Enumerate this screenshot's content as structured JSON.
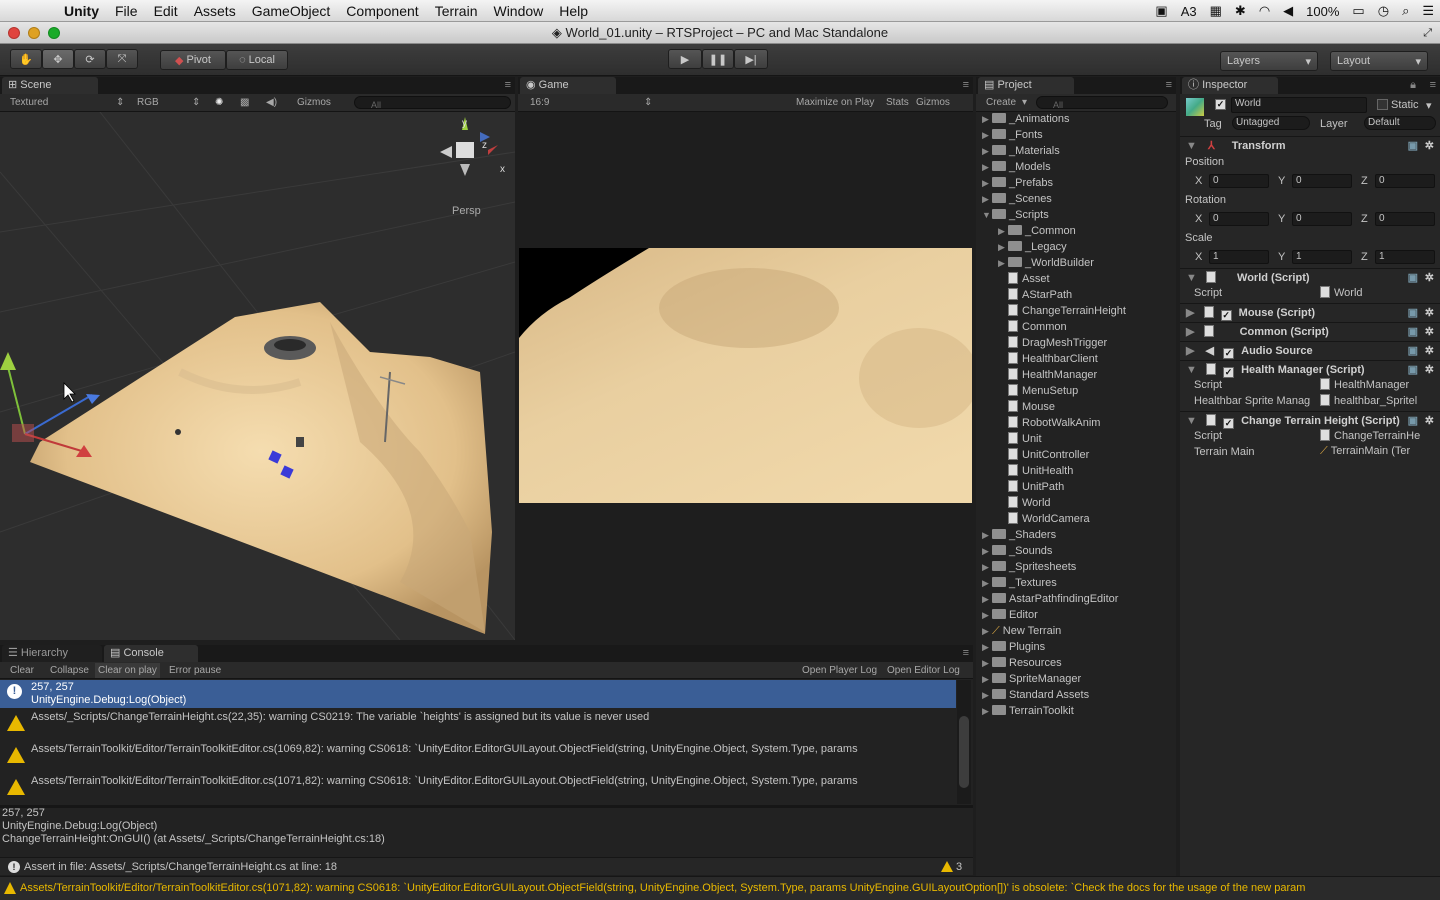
{
  "menubar": {
    "app": "Unity",
    "items": [
      "File",
      "Edit",
      "Assets",
      "GameObject",
      "Component",
      "Terrain",
      "Window",
      "Help"
    ],
    "status_num": "3",
    "battery": "100%"
  },
  "window": {
    "title": "World_01.unity – RTSProject – PC and Mac Standalone"
  },
  "toolbar": {
    "pivot": "Pivot",
    "local": "Local",
    "layers": "Layers",
    "layout": "Layout"
  },
  "scene": {
    "tab": "Scene",
    "draw_mode": "Textured",
    "color_mode": "RGB",
    "gizmos": "Gizmos",
    "search_placeholder": "All",
    "persp": "Persp",
    "axis_y": "y",
    "axis_x": "x",
    "axis_z": "z"
  },
  "game": {
    "tab": "Game",
    "aspect": "16:9",
    "maximize": "Maximize on Play",
    "stats": "Stats",
    "gizmos": "Gizmos"
  },
  "project": {
    "tab": "Project",
    "create": "Create",
    "search_placeholder": "All",
    "items": [
      {
        "label": "_Animations",
        "kind": "folder",
        "depth": 0,
        "arrow": "▶"
      },
      {
        "label": "_Fonts",
        "kind": "folder",
        "depth": 0,
        "arrow": "▶"
      },
      {
        "label": "_Materials",
        "kind": "folder",
        "depth": 0,
        "arrow": "▶"
      },
      {
        "label": "_Models",
        "kind": "folder",
        "depth": 0,
        "arrow": "▶"
      },
      {
        "label": "_Prefabs",
        "kind": "folder",
        "depth": 0,
        "arrow": "▶"
      },
      {
        "label": "_Scenes",
        "kind": "folder",
        "depth": 0,
        "arrow": "▶"
      },
      {
        "label": "_Scripts",
        "kind": "folder",
        "depth": 0,
        "arrow": "▼"
      },
      {
        "label": "_Common",
        "kind": "folder",
        "depth": 1,
        "arrow": "▶"
      },
      {
        "label": "_Legacy",
        "kind": "folder",
        "depth": 1,
        "arrow": "▶"
      },
      {
        "label": "_WorldBuilder",
        "kind": "folder",
        "depth": 1,
        "arrow": "▶"
      },
      {
        "label": "Asset",
        "kind": "file",
        "depth": 1,
        "arrow": ""
      },
      {
        "label": "AStarPath",
        "kind": "file",
        "depth": 1,
        "arrow": ""
      },
      {
        "label": "ChangeTerrainHeight",
        "kind": "file",
        "depth": 1,
        "arrow": ""
      },
      {
        "label": "Common",
        "kind": "file",
        "depth": 1,
        "arrow": ""
      },
      {
        "label": "DragMeshTrigger",
        "kind": "file",
        "depth": 1,
        "arrow": ""
      },
      {
        "label": "HealthbarClient",
        "kind": "file",
        "depth": 1,
        "arrow": ""
      },
      {
        "label": "HealthManager",
        "kind": "file",
        "depth": 1,
        "arrow": ""
      },
      {
        "label": "MenuSetup",
        "kind": "file",
        "depth": 1,
        "arrow": ""
      },
      {
        "label": "Mouse",
        "kind": "file",
        "depth": 1,
        "arrow": ""
      },
      {
        "label": "RobotWalkAnim",
        "kind": "file",
        "depth": 1,
        "arrow": ""
      },
      {
        "label": "Unit",
        "kind": "file",
        "depth": 1,
        "arrow": ""
      },
      {
        "label": "UnitController",
        "kind": "file",
        "depth": 1,
        "arrow": ""
      },
      {
        "label": "UnitHealth",
        "kind": "file",
        "depth": 1,
        "arrow": ""
      },
      {
        "label": "UnitPath",
        "kind": "file",
        "depth": 1,
        "arrow": ""
      },
      {
        "label": "World",
        "kind": "file",
        "depth": 1,
        "arrow": ""
      },
      {
        "label": "WorldCamera",
        "kind": "file",
        "depth": 1,
        "arrow": ""
      },
      {
        "label": "_Shaders",
        "kind": "folder",
        "depth": 0,
        "arrow": "▶"
      },
      {
        "label": "_Sounds",
        "kind": "folder",
        "depth": 0,
        "arrow": "▶"
      },
      {
        "label": "_Spritesheets",
        "kind": "folder",
        "depth": 0,
        "arrow": "▶"
      },
      {
        "label": "_Textures",
        "kind": "folder",
        "depth": 0,
        "arrow": "▶"
      },
      {
        "label": "AstarPathfindingEditor",
        "kind": "folder",
        "depth": 0,
        "arrow": "▶"
      },
      {
        "label": "Editor",
        "kind": "folder",
        "depth": 0,
        "arrow": "▶"
      },
      {
        "label": "New Terrain",
        "kind": "terrain",
        "depth": 0,
        "arrow": "▶"
      },
      {
        "label": "Plugins",
        "kind": "folder",
        "depth": 0,
        "arrow": "▶"
      },
      {
        "label": "Resources",
        "kind": "folder",
        "depth": 0,
        "arrow": "▶"
      },
      {
        "label": "SpriteManager",
        "kind": "folder",
        "depth": 0,
        "arrow": "▶"
      },
      {
        "label": "Standard Assets",
        "kind": "folder",
        "depth": 0,
        "arrow": "▶"
      },
      {
        "label": "TerrainToolkit",
        "kind": "folder",
        "depth": 0,
        "arrow": "▶"
      }
    ]
  },
  "inspector": {
    "tab": "Inspector",
    "object_name": "World",
    "static": "Static",
    "tag_label": "Tag",
    "tag_value": "Untagged",
    "layer_label": "Layer",
    "layer_value": "Default",
    "transform": "Transform",
    "position": "Position",
    "rotation": "Rotation",
    "scale": "Scale",
    "x": "X",
    "y": "Y",
    "z": "Z",
    "pos": [
      "0",
      "0",
      "0"
    ],
    "rot": [
      "0",
      "0",
      "0"
    ],
    "scl": [
      "1",
      "1",
      "1"
    ],
    "world_script": "World (Script)",
    "script_label": "Script",
    "world_script_value": "World",
    "mouse_script": "Mouse (Script)",
    "common_script": "Common (Script)",
    "audio_source": "Audio Source",
    "health_manager": "Health Manager (Script)",
    "health_script_value": "HealthManager",
    "healthbar_label": "Healthbar Sprite Manag",
    "healthbar_value": "healthbar_Spritel",
    "change_terrain": "Change Terrain Height (Script)",
    "change_terrain_value": "ChangeTerrainHe",
    "terrain_main_label": "Terrain Main",
    "terrain_main_value": "TerrainMain (Ter"
  },
  "hierarchy": {
    "tab": "Hierarchy"
  },
  "console": {
    "tab": "Console",
    "clear": "Clear",
    "collapse": "Collapse",
    "clear_on_play": "Clear on play",
    "error_pause": "Error pause",
    "open_player_log": "Open Player Log",
    "open_editor_log": "Open Editor Log",
    "entries": [
      {
        "line1": "257, 257",
        "line2": "UnityEngine.Debug:Log(Object)"
      },
      {
        "line1": "Assets/_Scripts/ChangeTerrainHeight.cs(22,35): warning CS0219: The variable `heights' is assigned but its value is never used"
      },
      {
        "line1": "Assets/TerrainToolkit/Editor/TerrainToolkitEditor.cs(1069,82): warning CS0618: `UnityEditor.EditorGUILayout.ObjectField(string, UnityEngine.Object, System.Type, params"
      },
      {
        "line1": "Assets/TerrainToolkit/Editor/TerrainToolkitEditor.cs(1071,82): warning CS0618: `UnityEditor.EditorGUILayout.ObjectField(string, UnityEngine.Object, System.Type, params"
      }
    ],
    "detail": [
      "257, 257",
      "UnityEngine.Debug:Log(Object)",
      "ChangeTerrainHeight:OnGUI() (at Assets/_Scripts/ChangeTerrainHeight.cs:18)"
    ],
    "assert": "Assert in file: Assets/_Scripts/ChangeTerrainHeight.cs at line: 18",
    "warn_count": "3"
  },
  "statusbar": {
    "text": "Assets/TerrainToolkit/Editor/TerrainToolkitEditor.cs(1071,82): warning CS0618: `UnityEditor.EditorGUILayout.ObjectField(string, UnityEngine.Object, System.Type, params UnityEngine.GUILayoutOption[])' is obsolete: `Check the docs for the usage of the new param"
  }
}
